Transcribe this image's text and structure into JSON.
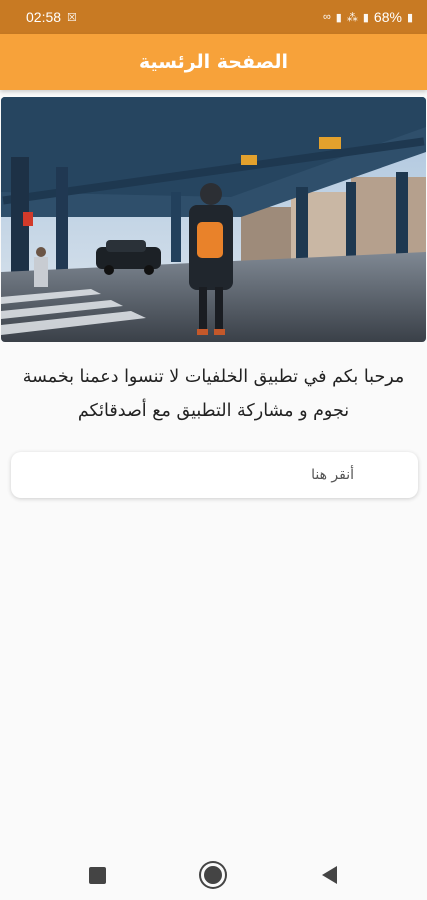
{
  "status_bar": {
    "time": "02:58",
    "battery": "68%",
    "icons": [
      "notification-icon",
      "link-icon",
      "wifi-icon",
      "signal-icon",
      "battery-icon"
    ]
  },
  "app_bar": {
    "title": "الصفحة الرئسية"
  },
  "hero": {
    "image": "city-street-photo"
  },
  "main": {
    "welcome_text": "مرحبا بكم في تطبيق الخلفيات لا تنسوا دعمنا بخمسة نجوم و مشاركة التطبيق مع أصدقائكم",
    "tap_label": "أنقر هنا"
  },
  "nav_bar": {
    "buttons": [
      "recents-button",
      "home-button",
      "back-button"
    ]
  },
  "colors": {
    "status_bar": "#c87a23",
    "app_bar": "#f7a23a",
    "background": "#fafafa"
  }
}
